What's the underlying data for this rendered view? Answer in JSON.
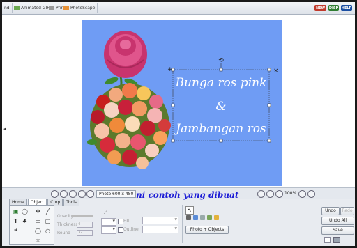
{
  "topbar": {
    "tabs": [
      {
        "label": "nd",
        "icon": "web-icon"
      },
      {
        "label": "Animated GIF",
        "icon": "gif-icon"
      },
      {
        "label": "Print",
        "icon": "print-icon"
      },
      {
        "label": "PhotoScape",
        "icon": "photoscape-icon"
      }
    ],
    "pills": [
      {
        "label": "NEW",
        "color": "#c0392b"
      },
      {
        "label": "DISP",
        "color": "#2f7d32"
      },
      {
        "label": "HELP",
        "color": "#1b4fa3"
      }
    ]
  },
  "canvas": {
    "background": "#6f9cf4",
    "text_lines": [
      "Bunga ros pink",
      "&",
      "Jambangan ros"
    ],
    "text_color": "#ffffff"
  },
  "statusbar": {
    "photo_size": "Photo 600 x 480",
    "zoom": "100%"
  },
  "caption": {
    "text": "ni contoh yang dibuat",
    "color": "#1d1dd6"
  },
  "panel": {
    "tabs": [
      "Home",
      "Object",
      "Crop",
      "Tools"
    ],
    "active_tab": "Object",
    "opacity_label": "Opacity",
    "thickness_label": "Thickness",
    "thickness_value": "4",
    "round_label": "Round",
    "round_value": "32",
    "fill_label": "Fill",
    "outline_label": "Outline",
    "photo_objects_label": "Photo + Objects"
  },
  "actions": {
    "undo": "Undo",
    "redo": "Redo",
    "undo_all": "Undo All",
    "save": "Save"
  }
}
